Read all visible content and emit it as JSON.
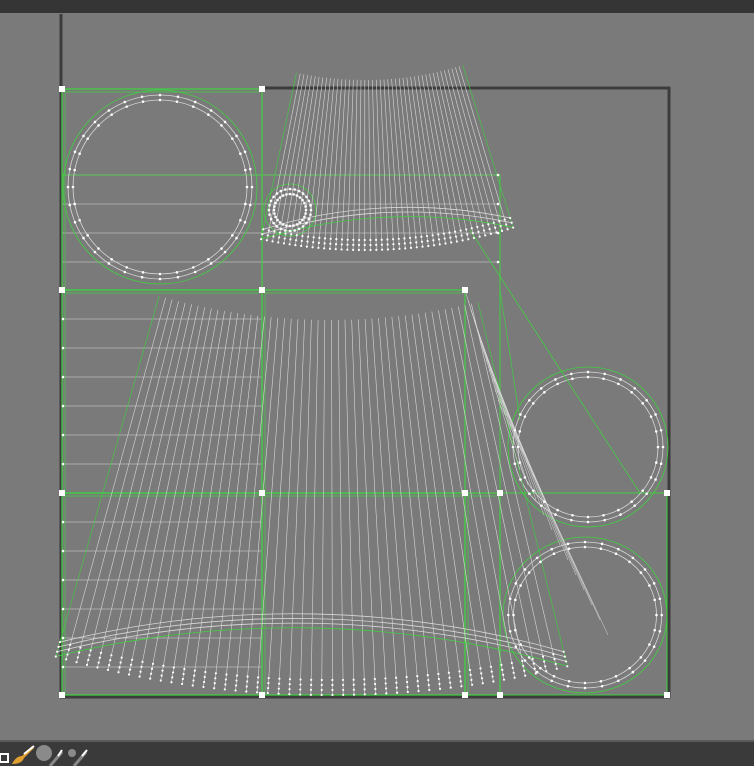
{
  "colors": {
    "background": "#7a7a7a",
    "bars": "#353535",
    "uv_edge": "#40d040",
    "mesh_line": "#d8d8d8",
    "vertex": "#ffffff",
    "bounds": "#3c3c3c"
  },
  "toolbar": {
    "tools": [
      {
        "icon": "select-box-icon"
      },
      {
        "icon": "paint-brush-icon"
      },
      {
        "icon": "brush-large-icon"
      },
      {
        "icon": "brush-small-icon"
      }
    ]
  }
}
